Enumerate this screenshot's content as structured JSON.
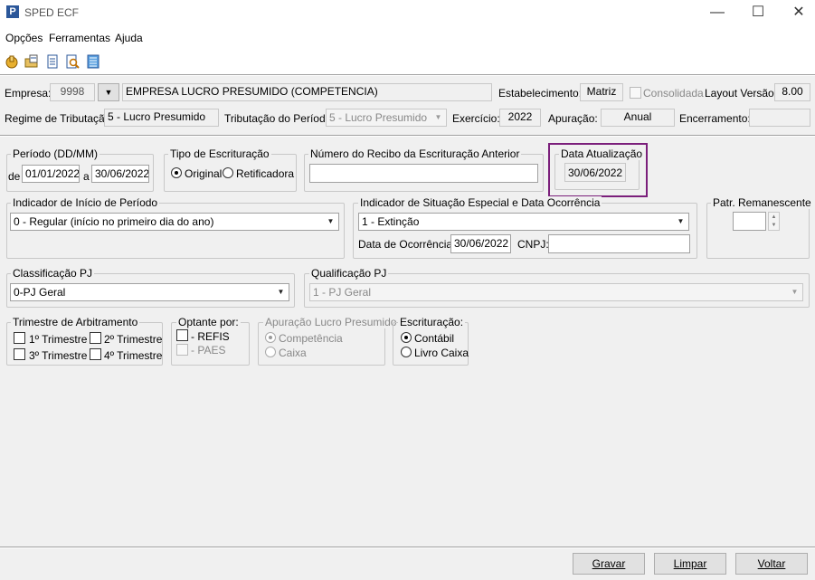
{
  "window": {
    "title": "SPED ECF",
    "app_icon": "P",
    "minimize": "—",
    "maximize": "☐",
    "close": "✕"
  },
  "menu": [
    "Opções",
    "Ferramentas",
    "Ajuda"
  ],
  "toolbar_icons": [
    "hand-icon",
    "folder-edit-icon",
    "document-icon",
    "document-search-icon",
    "bars-icon"
  ],
  "header": {
    "empresa_label": "Empresa:",
    "empresa_code": "9998",
    "empresa_name": "EMPRESA LUCRO PRESUMIDO (COMPETENCIA)",
    "estabelecimento_label": "Estabelecimento:",
    "estabelecimento_value": "Matriz",
    "consolidada_label": "Consolidada",
    "layout_label": "Layout Versão:",
    "layout_value": "8.00",
    "regime_label": "Regime de Tributação:",
    "regime_value": "5 - Lucro Presumido",
    "tributacao_label": "Tributação do Período:",
    "tributacao_value": "5 - Lucro Presumido",
    "exercicio_label": "Exercício:",
    "exercicio_value": "2022",
    "apuracao_label": "Apuração:",
    "apuracao_value": "Anual",
    "encerramento_label": "Encerramento:",
    "encerramento_value": ""
  },
  "periodo": {
    "legend": "Período (DD/MM)",
    "de_label": "de",
    "de_value": "01/01/2022",
    "a_label": "a",
    "a_value": "30/06/2022"
  },
  "tipo": {
    "legend": "Tipo de Escrituração",
    "original": "Original",
    "retificadora": "Retificadora"
  },
  "recibo": {
    "legend": "Número do Recibo da Escrituração Anterior",
    "value": ""
  },
  "data_atualizacao": {
    "legend": "Data Atualização",
    "value": "30/06/2022"
  },
  "indicador_inicio": {
    "legend": "Indicador de Início de Período",
    "value": "0 - Regular (início no primeiro dia do ano)"
  },
  "situacao": {
    "legend": "Indicador de Situação Especial e Data Ocorrência",
    "value": "1 - Extinção",
    "data_label": "Data de Ocorrência:",
    "data_value": "30/06/2022",
    "cnpj_label": "CNPJ:",
    "cnpj_value": ""
  },
  "patr": {
    "legend": "Patr. Remanescente",
    "value": ""
  },
  "classificacao": {
    "legend": "Classificação PJ",
    "value": "0-PJ Geral"
  },
  "qualificacao": {
    "legend": "Qualificação PJ",
    "value": "1 - PJ Geral"
  },
  "trimestre": {
    "legend": "Trimestre de Arbitramento",
    "t1": "1º Trimestre",
    "t2": "2º Trimestre",
    "t3": "3º Trimestre",
    "t4": "4º Trimestre"
  },
  "optante": {
    "legend": "Optante por:",
    "refis": "- REFIS",
    "paes": "- PAES"
  },
  "apuracao_lp": {
    "legend": "Apuração Lucro Presumido",
    "competencia": "Competência",
    "caixa": "Caixa"
  },
  "escrituracao": {
    "legend": "Escrituração:",
    "contabil": "Contábil",
    "livro_caixa": "Livro Caixa"
  },
  "buttons": {
    "gravar": "Gravar",
    "limpar": "Limpar",
    "voltar": "Voltar"
  },
  "colors": {
    "highlight": "#7b1f7b",
    "icon_blue": "#2b579a"
  }
}
